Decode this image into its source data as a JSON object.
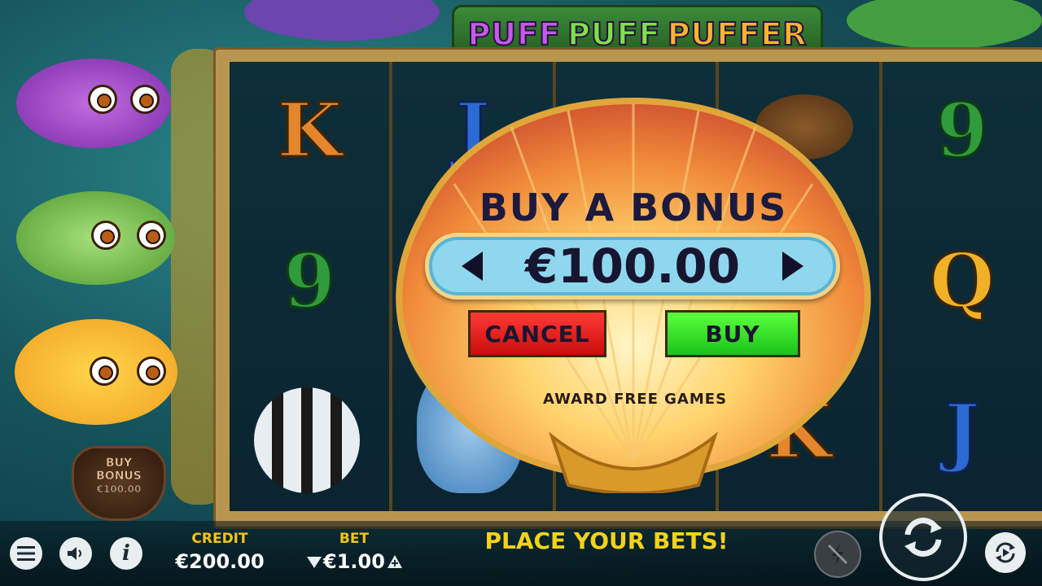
{
  "game": {
    "title_words": [
      "PUFF",
      "PUFF",
      "PUFFER"
    ]
  },
  "reels": {
    "symbols": {
      "r1_top": "K",
      "r1_mid": "9",
      "r2_top": "J",
      "r4_bot": "K",
      "r5_top": "9",
      "r5_mid": "Q",
      "r5_bot": "J"
    }
  },
  "side_bonus": {
    "line1": "BUY",
    "line2": "BONUS",
    "amount": "€100.00"
  },
  "dialog": {
    "title": "BUY A BONUS",
    "amount": "€100.00",
    "cancel_label": "CANCEL",
    "buy_label": "BUY",
    "footer": "AWARD FREE GAMES"
  },
  "footer": {
    "credit_label": "CREDIT",
    "credit_value": "€200.00",
    "bet_label": "BET",
    "bet_value": "€1.00",
    "message": "PLACE YOUR BETS!"
  },
  "icons": [
    "menu-icon",
    "sound-icon",
    "info-icon",
    "bet-decrease-icon",
    "bet-increase-icon",
    "turbo-off-icon",
    "spin-icon",
    "autoplay-icon"
  ]
}
